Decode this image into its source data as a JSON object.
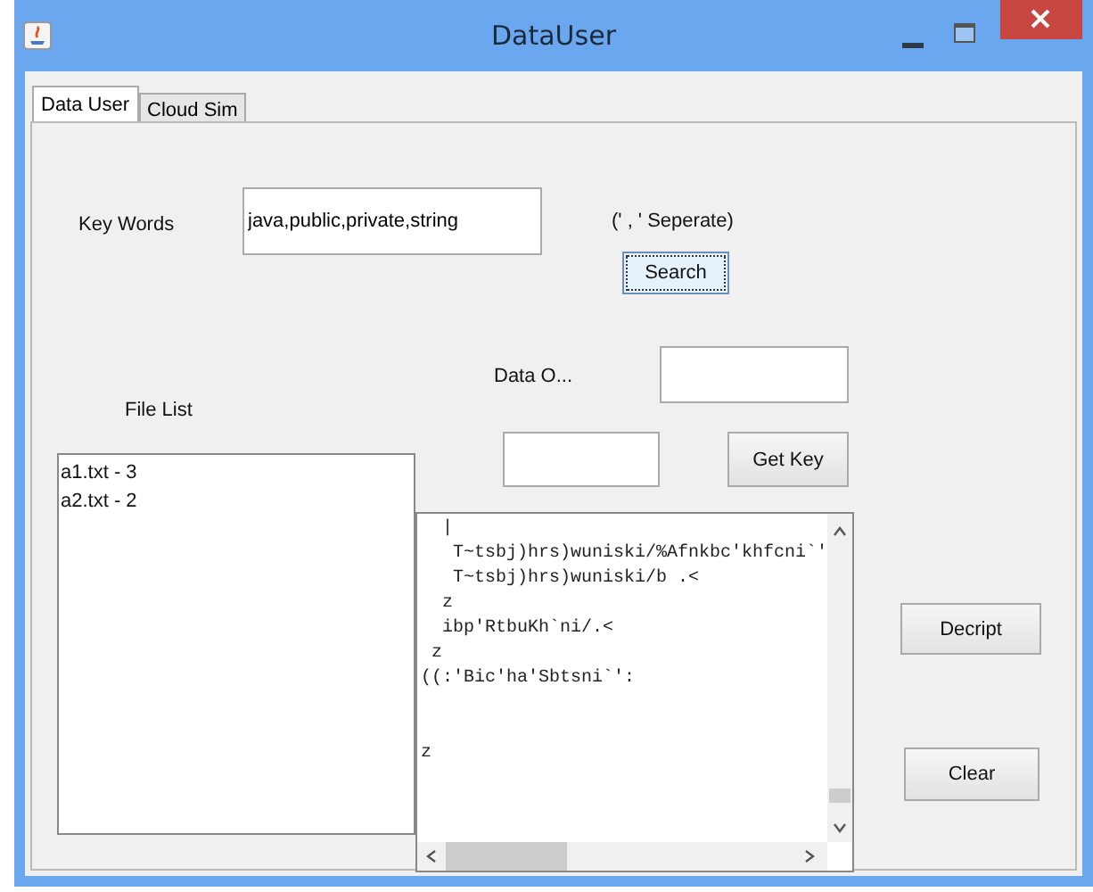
{
  "window": {
    "title": "DataUser"
  },
  "tabs": [
    {
      "label": "Data User",
      "selected": true
    },
    {
      "label": "Cloud Sim",
      "selected": false
    }
  ],
  "key_words": {
    "label": "Key Words",
    "value": "java,public,private,string",
    "hint": "(' , ' Seperate)"
  },
  "search_button": "Search",
  "data_owner": {
    "label": "Data O..."
  },
  "file_list": {
    "label": "File List",
    "items": [
      "a1.txt - 3",
      "a2.txt - 2"
    ]
  },
  "get_key_button": "Get Key",
  "cipher_lines": [
    "  |",
    "   T~tsbj)hrs)wuniski/%Afnkbc'khfcni`'",
    "   T~tsbj)hrs)wuniski/b .<",
    "  z",
    "  ibp'RtbuKh`ni/.<",
    " z",
    "((:'Bic'ha'Sbtsni`':"
  ],
  "cipher_tail_lines": [
    "z"
  ],
  "decrypt_button": "Decript",
  "clear_button": "Clear"
}
